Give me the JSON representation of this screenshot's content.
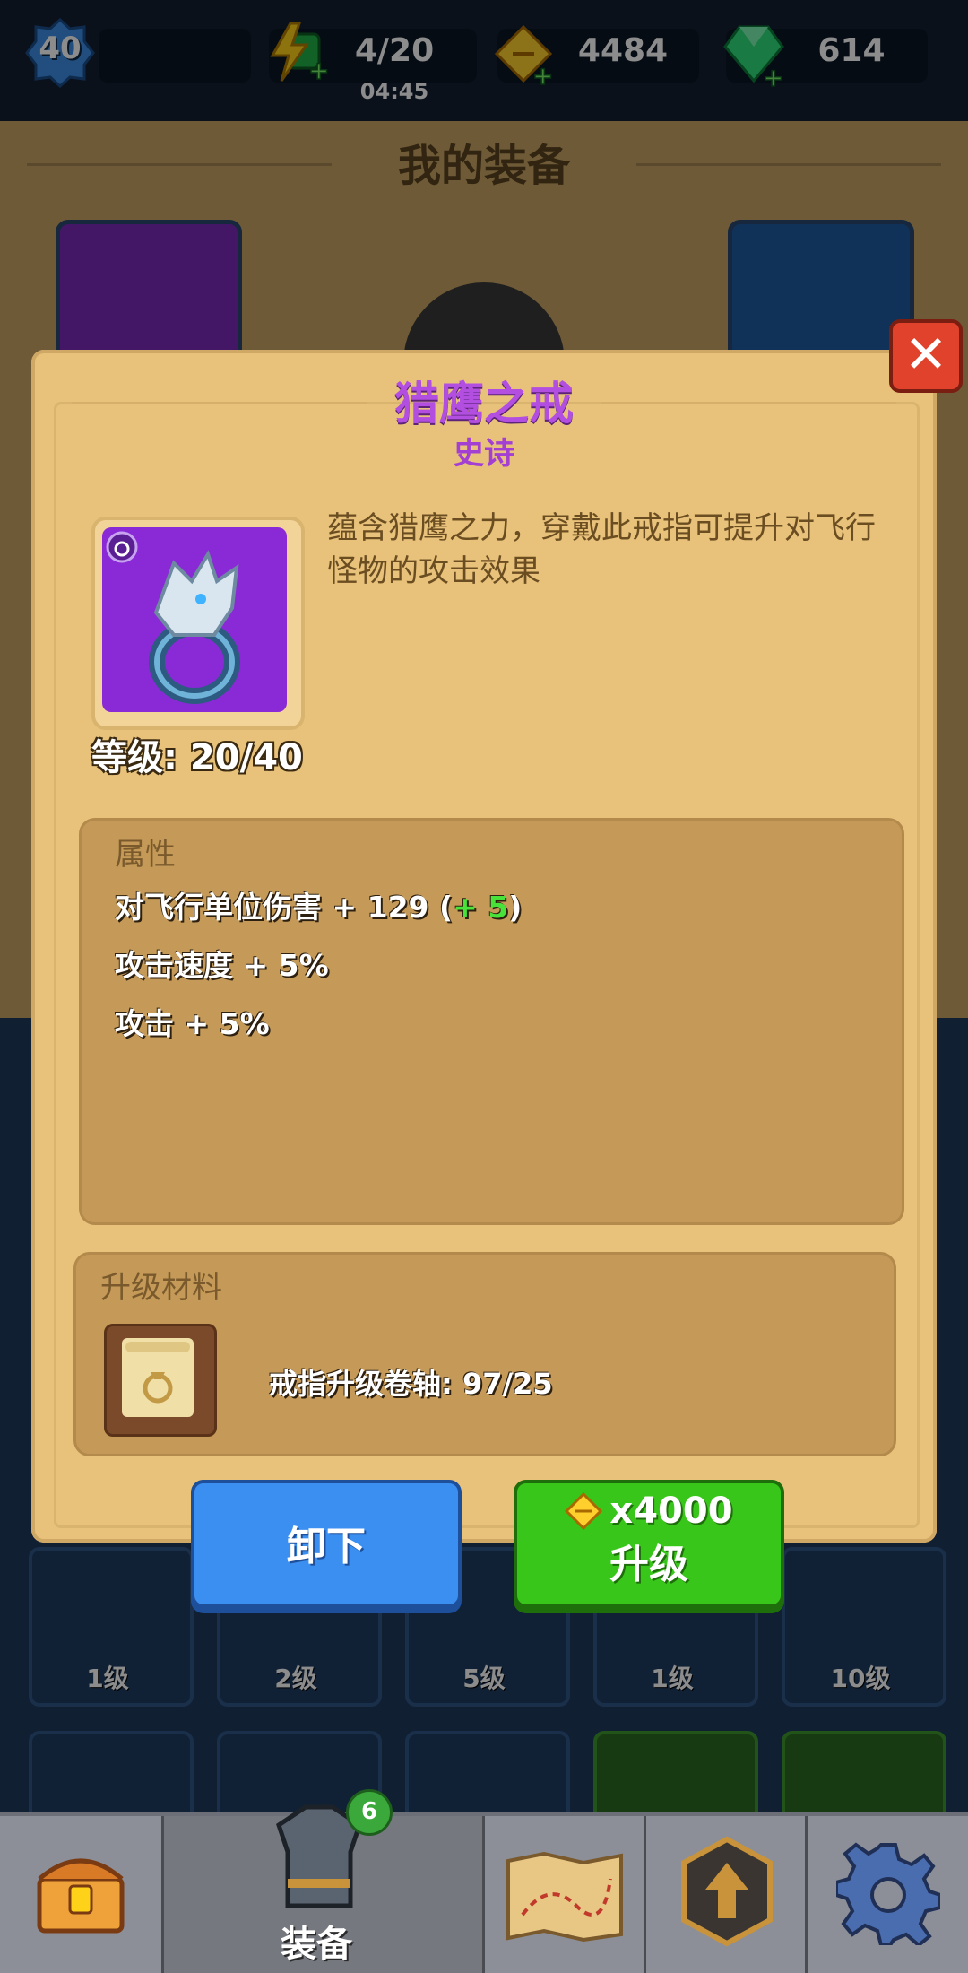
{
  "topbar": {
    "player_level": "40",
    "energy": "4/20",
    "energy_timer": "04:45",
    "gold": "4484",
    "gems": "614"
  },
  "page": {
    "title": "我的装备"
  },
  "dialog": {
    "item_name": "猎鹰之戒",
    "rarity": "史诗",
    "description": "蕴含猎鹰之力，穿戴此戒指可提升对飞行怪物的攻击效果",
    "level": "等级: 20/40",
    "attributes_title": "属性",
    "stats": [
      {
        "label": "对飞行单位伤害",
        "value": "+ 129",
        "bonus_open": " (",
        "bonus": "+ 5",
        "bonus_close": ")"
      },
      {
        "label": "攻击速度",
        "value": "+ 5%"
      },
      {
        "label": "攻击",
        "value": "+ 5%"
      }
    ],
    "materials_title": "升级材料",
    "material": "戒指升级卷轴: 97/25",
    "unequip_label": "卸下",
    "upgrade_cost": "x4000",
    "upgrade_label": "升级"
  },
  "inventory_levels": [
    "1级",
    "2级",
    "5级",
    "1级",
    "10级"
  ],
  "nav": {
    "equipment_label": "装备",
    "equipment_badge": "6"
  },
  "colors": {
    "dialog_bg": "#e8c27a",
    "epic_purple": "#b34fe0",
    "unequip_blue": "#3b8ff0",
    "upgrade_green": "#39c61a",
    "close_red": "#e0422b"
  }
}
